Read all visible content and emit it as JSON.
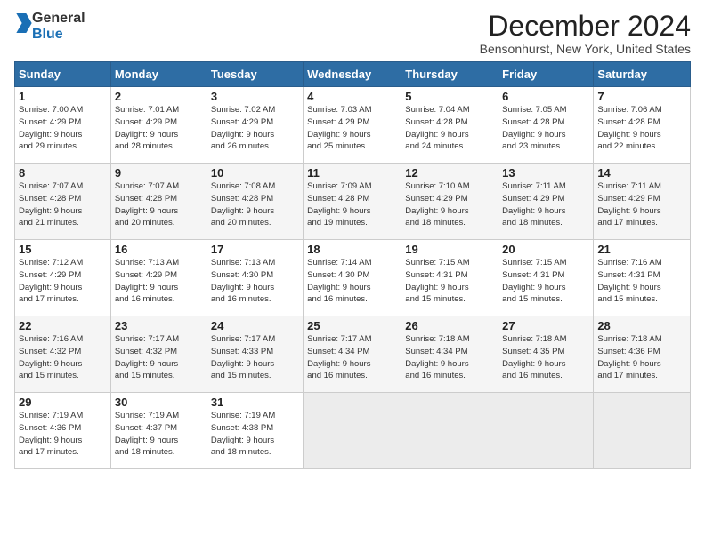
{
  "logo": {
    "line1": "General",
    "line2": "Blue"
  },
  "title": "December 2024",
  "location": "Bensonhurst, New York, United States",
  "header_days": [
    "Sunday",
    "Monday",
    "Tuesday",
    "Wednesday",
    "Thursday",
    "Friday",
    "Saturday"
  ],
  "weeks": [
    [
      {
        "day": 1,
        "info": "Sunrise: 7:00 AM\nSunset: 4:29 PM\nDaylight: 9 hours\nand 29 minutes."
      },
      {
        "day": 2,
        "info": "Sunrise: 7:01 AM\nSunset: 4:29 PM\nDaylight: 9 hours\nand 28 minutes."
      },
      {
        "day": 3,
        "info": "Sunrise: 7:02 AM\nSunset: 4:29 PM\nDaylight: 9 hours\nand 26 minutes."
      },
      {
        "day": 4,
        "info": "Sunrise: 7:03 AM\nSunset: 4:29 PM\nDaylight: 9 hours\nand 25 minutes."
      },
      {
        "day": 5,
        "info": "Sunrise: 7:04 AM\nSunset: 4:28 PM\nDaylight: 9 hours\nand 24 minutes."
      },
      {
        "day": 6,
        "info": "Sunrise: 7:05 AM\nSunset: 4:28 PM\nDaylight: 9 hours\nand 23 minutes."
      },
      {
        "day": 7,
        "info": "Sunrise: 7:06 AM\nSunset: 4:28 PM\nDaylight: 9 hours\nand 22 minutes."
      }
    ],
    [
      {
        "day": 8,
        "info": "Sunrise: 7:07 AM\nSunset: 4:28 PM\nDaylight: 9 hours\nand 21 minutes."
      },
      {
        "day": 9,
        "info": "Sunrise: 7:07 AM\nSunset: 4:28 PM\nDaylight: 9 hours\nand 20 minutes."
      },
      {
        "day": 10,
        "info": "Sunrise: 7:08 AM\nSunset: 4:28 PM\nDaylight: 9 hours\nand 20 minutes."
      },
      {
        "day": 11,
        "info": "Sunrise: 7:09 AM\nSunset: 4:28 PM\nDaylight: 9 hours\nand 19 minutes."
      },
      {
        "day": 12,
        "info": "Sunrise: 7:10 AM\nSunset: 4:29 PM\nDaylight: 9 hours\nand 18 minutes."
      },
      {
        "day": 13,
        "info": "Sunrise: 7:11 AM\nSunset: 4:29 PM\nDaylight: 9 hours\nand 18 minutes."
      },
      {
        "day": 14,
        "info": "Sunrise: 7:11 AM\nSunset: 4:29 PM\nDaylight: 9 hours\nand 17 minutes."
      }
    ],
    [
      {
        "day": 15,
        "info": "Sunrise: 7:12 AM\nSunset: 4:29 PM\nDaylight: 9 hours\nand 17 minutes."
      },
      {
        "day": 16,
        "info": "Sunrise: 7:13 AM\nSunset: 4:29 PM\nDaylight: 9 hours\nand 16 minutes."
      },
      {
        "day": 17,
        "info": "Sunrise: 7:13 AM\nSunset: 4:30 PM\nDaylight: 9 hours\nand 16 minutes."
      },
      {
        "day": 18,
        "info": "Sunrise: 7:14 AM\nSunset: 4:30 PM\nDaylight: 9 hours\nand 16 minutes."
      },
      {
        "day": 19,
        "info": "Sunrise: 7:15 AM\nSunset: 4:31 PM\nDaylight: 9 hours\nand 15 minutes."
      },
      {
        "day": 20,
        "info": "Sunrise: 7:15 AM\nSunset: 4:31 PM\nDaylight: 9 hours\nand 15 minutes."
      },
      {
        "day": 21,
        "info": "Sunrise: 7:16 AM\nSunset: 4:31 PM\nDaylight: 9 hours\nand 15 minutes."
      }
    ],
    [
      {
        "day": 22,
        "info": "Sunrise: 7:16 AM\nSunset: 4:32 PM\nDaylight: 9 hours\nand 15 minutes."
      },
      {
        "day": 23,
        "info": "Sunrise: 7:17 AM\nSunset: 4:32 PM\nDaylight: 9 hours\nand 15 minutes."
      },
      {
        "day": 24,
        "info": "Sunrise: 7:17 AM\nSunset: 4:33 PM\nDaylight: 9 hours\nand 15 minutes."
      },
      {
        "day": 25,
        "info": "Sunrise: 7:17 AM\nSunset: 4:34 PM\nDaylight: 9 hours\nand 16 minutes."
      },
      {
        "day": 26,
        "info": "Sunrise: 7:18 AM\nSunset: 4:34 PM\nDaylight: 9 hours\nand 16 minutes."
      },
      {
        "day": 27,
        "info": "Sunrise: 7:18 AM\nSunset: 4:35 PM\nDaylight: 9 hours\nand 16 minutes."
      },
      {
        "day": 28,
        "info": "Sunrise: 7:18 AM\nSunset: 4:36 PM\nDaylight: 9 hours\nand 17 minutes."
      }
    ],
    [
      {
        "day": 29,
        "info": "Sunrise: 7:19 AM\nSunset: 4:36 PM\nDaylight: 9 hours\nand 17 minutes."
      },
      {
        "day": 30,
        "info": "Sunrise: 7:19 AM\nSunset: 4:37 PM\nDaylight: 9 hours\nand 18 minutes."
      },
      {
        "day": 31,
        "info": "Sunrise: 7:19 AM\nSunset: 4:38 PM\nDaylight: 9 hours\nand 18 minutes."
      },
      null,
      null,
      null,
      null
    ]
  ]
}
